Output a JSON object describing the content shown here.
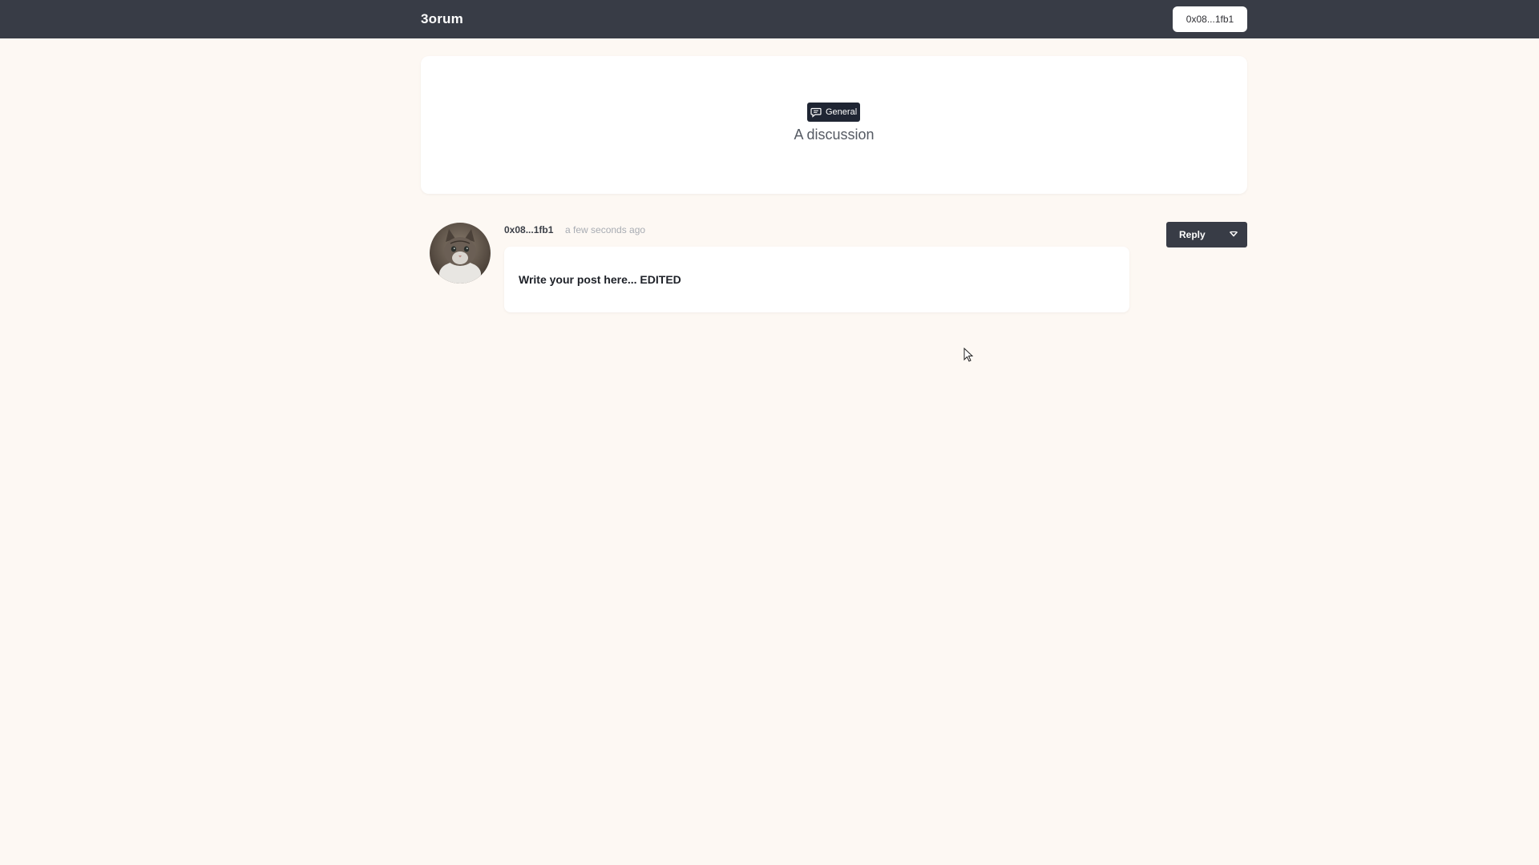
{
  "topbar": {
    "brand": "3orum",
    "wallet_label": "0x08...1fb1"
  },
  "thread": {
    "category": "General",
    "category_icon": "chat-bubble-icon",
    "title": "A discussion"
  },
  "post": {
    "author": "0x08...1fb1",
    "timestamp": "a few seconds ago",
    "body": "Write your post here... EDITED",
    "avatar": "kitten-avatar",
    "reply_label": "Reply",
    "dropdown_icon": "chevron-down-icon"
  },
  "colors": {
    "background": "#fdf8f3",
    "topbar": "#383c46",
    "badge": "#1f2533",
    "card": "#ffffff"
  }
}
